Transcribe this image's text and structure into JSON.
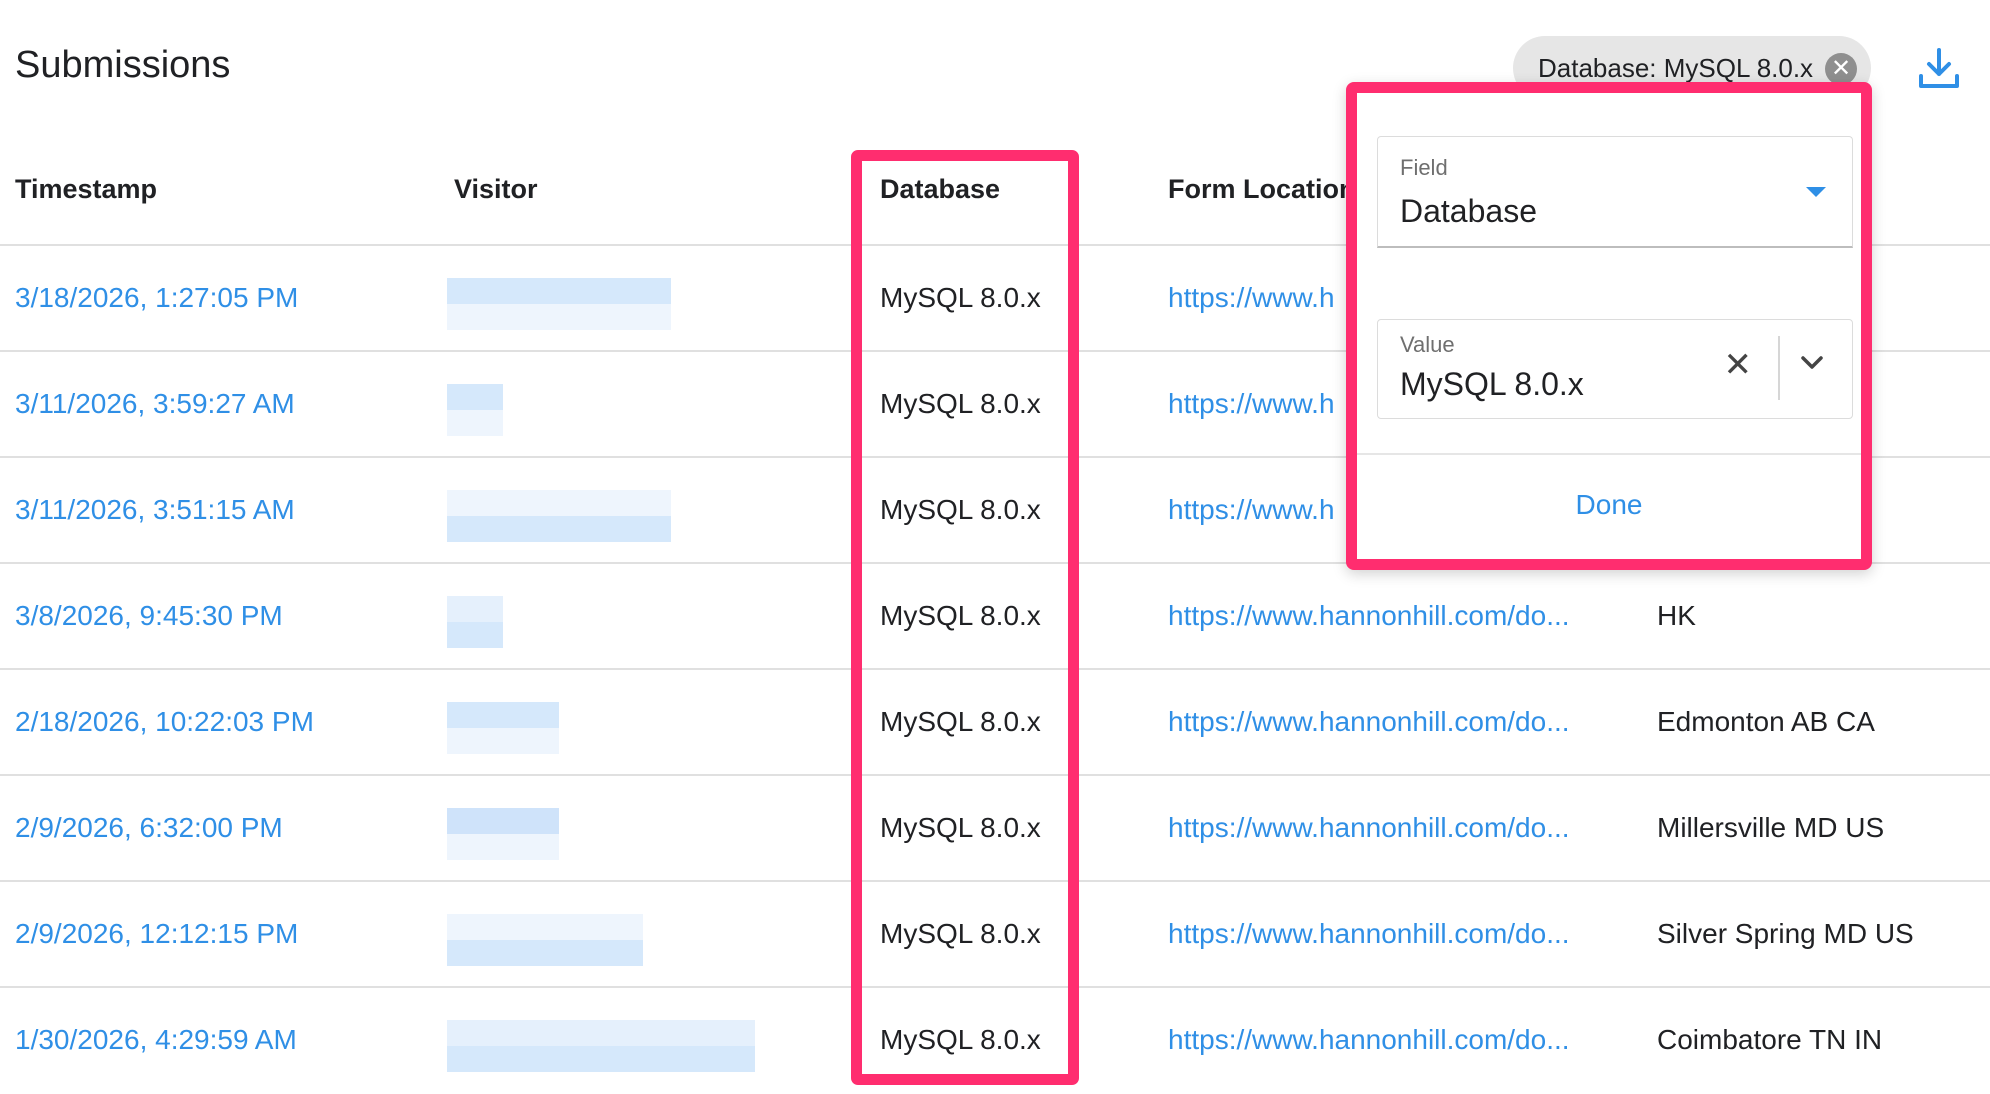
{
  "page": {
    "title": "Submissions"
  },
  "filter_chip": {
    "label": "Database: MySQL 8.0.x",
    "close_glyph": "✕"
  },
  "toolbar": {
    "download_icon": "download-icon"
  },
  "columns": {
    "timestamp": "Timestamp",
    "visitor": "Visitor",
    "database": "Database",
    "form_location": "Form Location"
  },
  "rows": [
    {
      "timestamp": "3/18/2026, 1:27:05 PM",
      "database": "MySQL 8.0.x",
      "form_location": "https://www.h",
      "geo": ""
    },
    {
      "timestamp": "3/11/2026, 3:59:27 AM",
      "database": "MySQL 8.0.x",
      "form_location": "https://www.h",
      "geo": ""
    },
    {
      "timestamp": "3/11/2026, 3:51:15 AM",
      "database": "MySQL 8.0.x",
      "form_location": "https://www.h",
      "geo": ""
    },
    {
      "timestamp": "3/8/2026, 9:45:30 PM",
      "database": "MySQL 8.0.x",
      "form_location": "https://www.hannonhill.com/do...",
      "geo": "HK"
    },
    {
      "timestamp": "2/18/2026, 10:22:03 PM",
      "database": "MySQL 8.0.x",
      "form_location": "https://www.hannonhill.com/do...",
      "geo": "Edmonton AB CA"
    },
    {
      "timestamp": "2/9/2026, 6:32:00 PM",
      "database": "MySQL 8.0.x",
      "form_location": "https://www.hannonhill.com/do...",
      "geo": "Millersville MD US"
    },
    {
      "timestamp": "2/9/2026, 12:12:15 PM",
      "database": "MySQL 8.0.x",
      "form_location": "https://www.hannonhill.com/do...",
      "geo": "Silver Spring MD US"
    },
    {
      "timestamp": "1/30/2026, 4:29:59 AM",
      "database": "MySQL 8.0.x",
      "form_location": "https://www.hannonhill.com/do...",
      "geo": "Coimbatore TN IN"
    }
  ],
  "filter_popover": {
    "field_label": "Field",
    "field_value": "Database",
    "value_label": "Value",
    "value_value": "MySQL 8.0.x",
    "clear_glyph": "✕",
    "done_label": "Done"
  },
  "colors": {
    "accent": "#2f8fe6",
    "highlight": "#ff2d6f",
    "chip_bg": "#e6e6e6"
  }
}
